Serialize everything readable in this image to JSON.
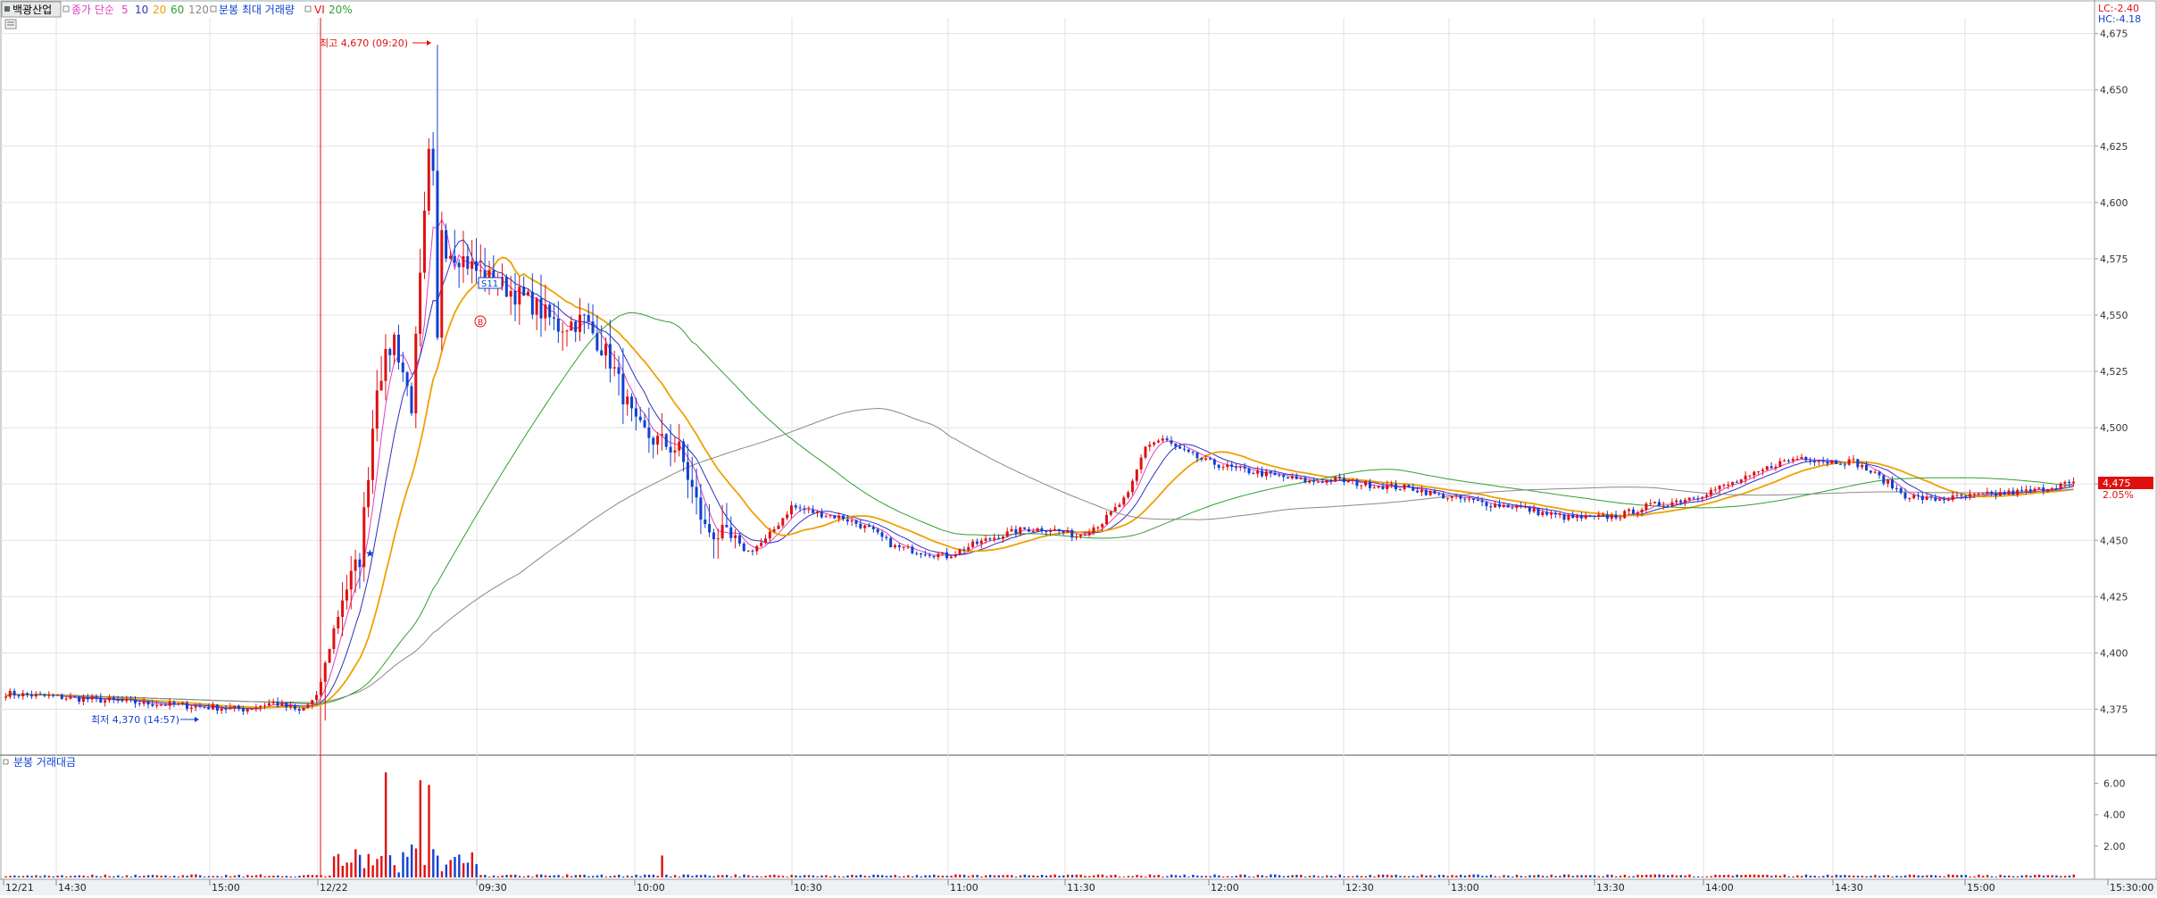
{
  "header": {
    "stock_name": "백광산업",
    "indicator_prefix": "종가 단순",
    "ma_labels": [
      "5",
      "10",
      "20",
      "60",
      "120"
    ],
    "volume_label": "분봉 최대 거래량",
    "vi_label": "VI",
    "vi_value": "20%"
  },
  "colors": {
    "ma5": "#e040c0",
    "ma10": "#3030c0",
    "ma20": "#f0a000",
    "ma60": "#30a030",
    "ma120": "#888888",
    "up": "#e01010",
    "down": "#1040d0",
    "grid": "#e2e2e2",
    "session_line": "#e01010"
  },
  "right_labels": {
    "lc": "LC:-2.40",
    "hc": "HC:-4.18",
    "current_price": "4,475",
    "change_pct": "2.05%"
  },
  "annotations": {
    "high": "최고 4,670 (09:20)",
    "low": "최저 4,370 (14:57)",
    "marker_s": "S11",
    "marker_b": "B"
  },
  "volume_panel": {
    "title": "분봉 거래대금",
    "tick_labels": [
      "6.00",
      "4.00",
      "2.00"
    ],
    "tick_values": [
      6,
      4,
      2
    ]
  },
  "chart_data": {
    "type": "candlestick",
    "price_axis": {
      "ylim": [
        4355,
        4680
      ],
      "ticks": [
        4375,
        4400,
        4425,
        4450,
        4475,
        4500,
        4525,
        4550,
        4575,
        4600,
        4625,
        4650,
        4675
      ],
      "tick_labels": [
        "4,375",
        "4,400",
        "4,425",
        "4,450",
        "4,475",
        "4,500",
        "4,525",
        "4,550",
        "4,575",
        "4,600",
        "4,625",
        "4,650",
        "4,675"
      ]
    },
    "time_axis": {
      "labels": [
        "12/21",
        "14:30",
        "15:00",
        "12/22",
        "09:30",
        "10:00",
        "10:30",
        "11:00",
        "11:30",
        "12:00",
        "12:30",
        "13:00",
        "13:30",
        "14:00",
        "14:30",
        "15:00",
        "15:30:00"
      ]
    },
    "price_path": [
      [
        0,
        4382
      ],
      [
        30,
        4378
      ],
      [
        55,
        4375
      ],
      [
        62,
        4378
      ],
      [
        68,
        4374
      ],
      [
        72,
        4380
      ],
      [
        78,
        4425
      ],
      [
        82,
        4442
      ],
      [
        86,
        4520
      ],
      [
        90,
        4540
      ],
      [
        94,
        4510
      ],
      [
        98,
        4620
      ],
      [
        102,
        4580
      ],
      [
        106,
        4575
      ],
      [
        110,
        4568
      ],
      [
        116,
        4562
      ],
      [
        122,
        4555
      ],
      [
        128,
        4545
      ],
      [
        134,
        4548
      ],
      [
        140,
        4530
      ],
      [
        146,
        4500
      ],
      [
        150,
        4495
      ],
      [
        156,
        4490
      ],
      [
        162,
        4455
      ],
      [
        166,
        4452
      ],
      [
        172,
        4445
      ],
      [
        176,
        4450
      ],
      [
        182,
        4465
      ],
      [
        188,
        4462
      ],
      [
        194,
        4460
      ],
      [
        200,
        4455
      ],
      [
        206,
        4447
      ],
      [
        212,
        4445
      ],
      [
        218,
        4443
      ],
      [
        224,
        4448
      ],
      [
        230,
        4452
      ],
      [
        236,
        4455
      ],
      [
        242,
        4455
      ],
      [
        248,
        4452
      ],
      [
        254,
        4458
      ],
      [
        260,
        4470
      ],
      [
        264,
        4492
      ],
      [
        268,
        4495
      ],
      [
        272,
        4490
      ],
      [
        278,
        4485
      ],
      [
        284,
        4482
      ],
      [
        290,
        4480
      ],
      [
        296,
        4478
      ],
      [
        302,
        4476
      ],
      [
        308,
        4477
      ],
      [
        314,
        4475
      ],
      [
        320,
        4474
      ],
      [
        326,
        4473
      ],
      [
        332,
        4470
      ],
      [
        338,
        4468
      ],
      [
        344,
        4466
      ],
      [
        350,
        4465
      ],
      [
        356,
        4462
      ],
      [
        362,
        4460
      ],
      [
        368,
        4460
      ],
      [
        374,
        4461
      ],
      [
        380,
        4465
      ],
      [
        386,
        4467
      ],
      [
        392,
        4470
      ],
      [
        398,
        4474
      ],
      [
        404,
        4478
      ],
      [
        410,
        4484
      ],
      [
        416,
        4487
      ],
      [
        422,
        4485
      ],
      [
        428,
        4485
      ],
      [
        434,
        4478
      ],
      [
        440,
        4470
      ],
      [
        446,
        4468
      ],
      [
        452,
        4469
      ],
      [
        458,
        4470
      ],
      [
        464,
        4471
      ],
      [
        470,
        4472
      ],
      [
        476,
        4475
      ]
    ],
    "high": {
      "value": 4670,
      "time": "09:20"
    },
    "low": {
      "value": 4370,
      "time": "14:57"
    },
    "ma_labels": [
      "5",
      "10",
      "20",
      "60",
      "120"
    ]
  }
}
